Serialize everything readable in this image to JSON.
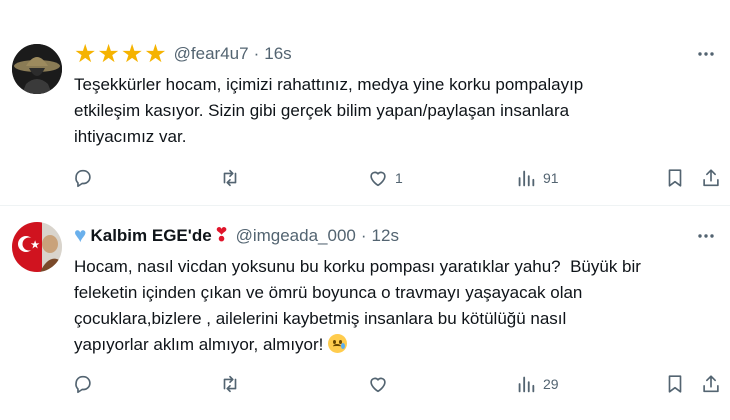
{
  "tweets": [
    {
      "avatar": "hat-figure-avatar",
      "stars": "★★★★",
      "name": "",
      "handle": "@fear4u7",
      "time": "16s",
      "text": "Teşekkürler hocam, içimizi rahattınız, medya yine korku pompalayıp\netkileşim kasıyor. Sizin gibi gerçek bilim yapan/paylaşan insanlara\nihtiyacımız var.",
      "emoji": "",
      "actions": {
        "reply": "",
        "retweet": "",
        "like": "1",
        "views": "91"
      }
    },
    {
      "avatar": "turkish-flag-avatar",
      "name": "Kalbim EGE'de",
      "handle": "@imgeada_000",
      "time": "12s",
      "text": "Hocam, nasıl vicdan yoksunu bu korku pompası yaratıklar yahu?  Büyük bir\nfeleketin içinden çıkan ve ömrü boyunca o travmayı yaşayacak olan\nçocuklara,bizlere , ailelerini kaybetmiş insanlara bu kötülüğü nasıl\nyapıyorlar aklım almıyor, almıyor! ",
      "emoji": "crying-face",
      "actions": {
        "reply": "",
        "retweet": "",
        "like": "",
        "views": "29"
      }
    }
  ],
  "colors": {
    "text": "#0f1419",
    "muted": "#536471",
    "star": "#f5b301",
    "divider": "#eff3f4"
  }
}
